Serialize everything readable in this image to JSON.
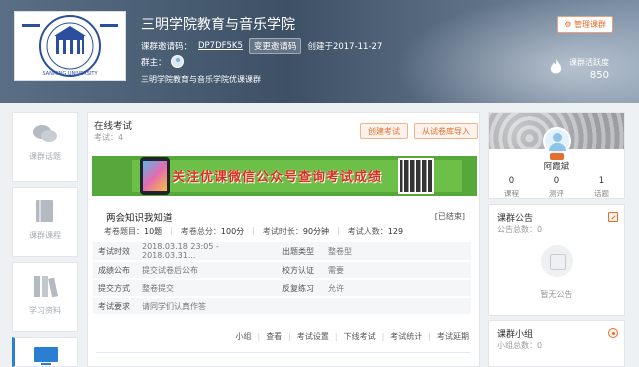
{
  "header": {
    "title": "三明学院教育与音乐学院",
    "invite_label": "课群邀请码：",
    "invite_code": "DP7DF5K5",
    "change_invite": "变更邀请码",
    "created": "创建于2017-11-27",
    "owner_label": "群主：",
    "description": "三明学院教育与音乐学院优课课群",
    "manage_button": "管理课群",
    "activity_label": "课群活跃度",
    "activity_value": "850",
    "logo_text": "SANMING UNIVERSITY"
  },
  "nav": [
    {
      "label": "课群话题",
      "icon": "chat-icon"
    },
    {
      "label": "课群课程",
      "icon": "book-icon"
    },
    {
      "label": "学习资料",
      "icon": "library-icon"
    },
    {
      "label": "",
      "icon": "monitor-icon"
    }
  ],
  "main": {
    "title": "在线考试",
    "count": "考试：4",
    "create_button": "创建考试",
    "import_button": "从试卷库导入",
    "banner_text": "关注优课微信公众号查询考试成绩"
  },
  "quiz": {
    "name": "两会知识我知道",
    "status": "[已结束]",
    "stats": [
      {
        "label": "考卷题目：",
        "value": "10题"
      },
      {
        "label": "考卷总分：",
        "value": "100分"
      },
      {
        "label": "考试时长：",
        "value": "90分钟"
      },
      {
        "label": "考试人数：",
        "value": "129"
      }
    ],
    "rows": [
      {
        "k1": "考试时效",
        "v1": "2018.03.18 23:05 - 2018.03.31...",
        "k2": "出题类型",
        "v2": "整卷型"
      },
      {
        "k1": "成绩公布",
        "v1": "提交试卷后公布",
        "k2": "校方认证",
        "v2": "需要"
      },
      {
        "k1": "提交方式",
        "v1": "整卷提交",
        "k2": "反复练习",
        "v2": "允许"
      },
      {
        "k1": "考试要求",
        "v1": "请同学们认真作答",
        "k2": "",
        "v2": ""
      }
    ],
    "actions": [
      "小组",
      "查看",
      "考试设置",
      "下线考试",
      "考试统计",
      "考试延期"
    ]
  },
  "profile": {
    "name": "阿霞斌",
    "stats": [
      {
        "n": "0",
        "l": "课程"
      },
      {
        "n": "0",
        "l": "测评"
      },
      {
        "n": "1",
        "l": "话题"
      }
    ]
  },
  "announcement": {
    "title": "课群公告",
    "sub": "公告总数：0",
    "empty": "暂无公告"
  },
  "groups": {
    "title": "课群小组",
    "sub": "小组总数：0"
  },
  "colors": {
    "accent": "#e46e2d",
    "header_bg": "#4a5e75",
    "banner_green": "#57a83a"
  }
}
